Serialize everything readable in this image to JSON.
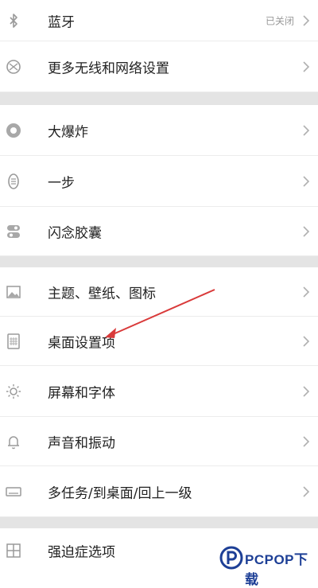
{
  "settings": {
    "items": [
      {
        "icon": "bluetooth-icon",
        "label": "蓝牙",
        "status": "已关闭"
      },
      {
        "icon": "wireless-network-icon",
        "label": "更多无线和网络设置"
      },
      {
        "icon": "big-bang-icon",
        "label": "大爆炸"
      },
      {
        "icon": "one-step-icon",
        "label": "一步"
      },
      {
        "icon": "flash-capsule-icon",
        "label": "闪念胶囊"
      },
      {
        "icon": "theme-icon",
        "label": "主题、壁纸、图标"
      },
      {
        "icon": "desktop-grid-icon",
        "label": "桌面设置项"
      },
      {
        "icon": "brightness-icon",
        "label": "屏幕和字体"
      },
      {
        "icon": "bell-icon",
        "label": "声音和振动"
      },
      {
        "icon": "multitask-icon",
        "label": "多任务/到桌面/回上一级"
      },
      {
        "icon": "grid-icon",
        "label": "强迫症选项"
      }
    ]
  },
  "annotation": {
    "arrow_color": "#d93a3a"
  },
  "watermark": {
    "text": "PCPOP下载",
    "color": "#1d3f96"
  }
}
